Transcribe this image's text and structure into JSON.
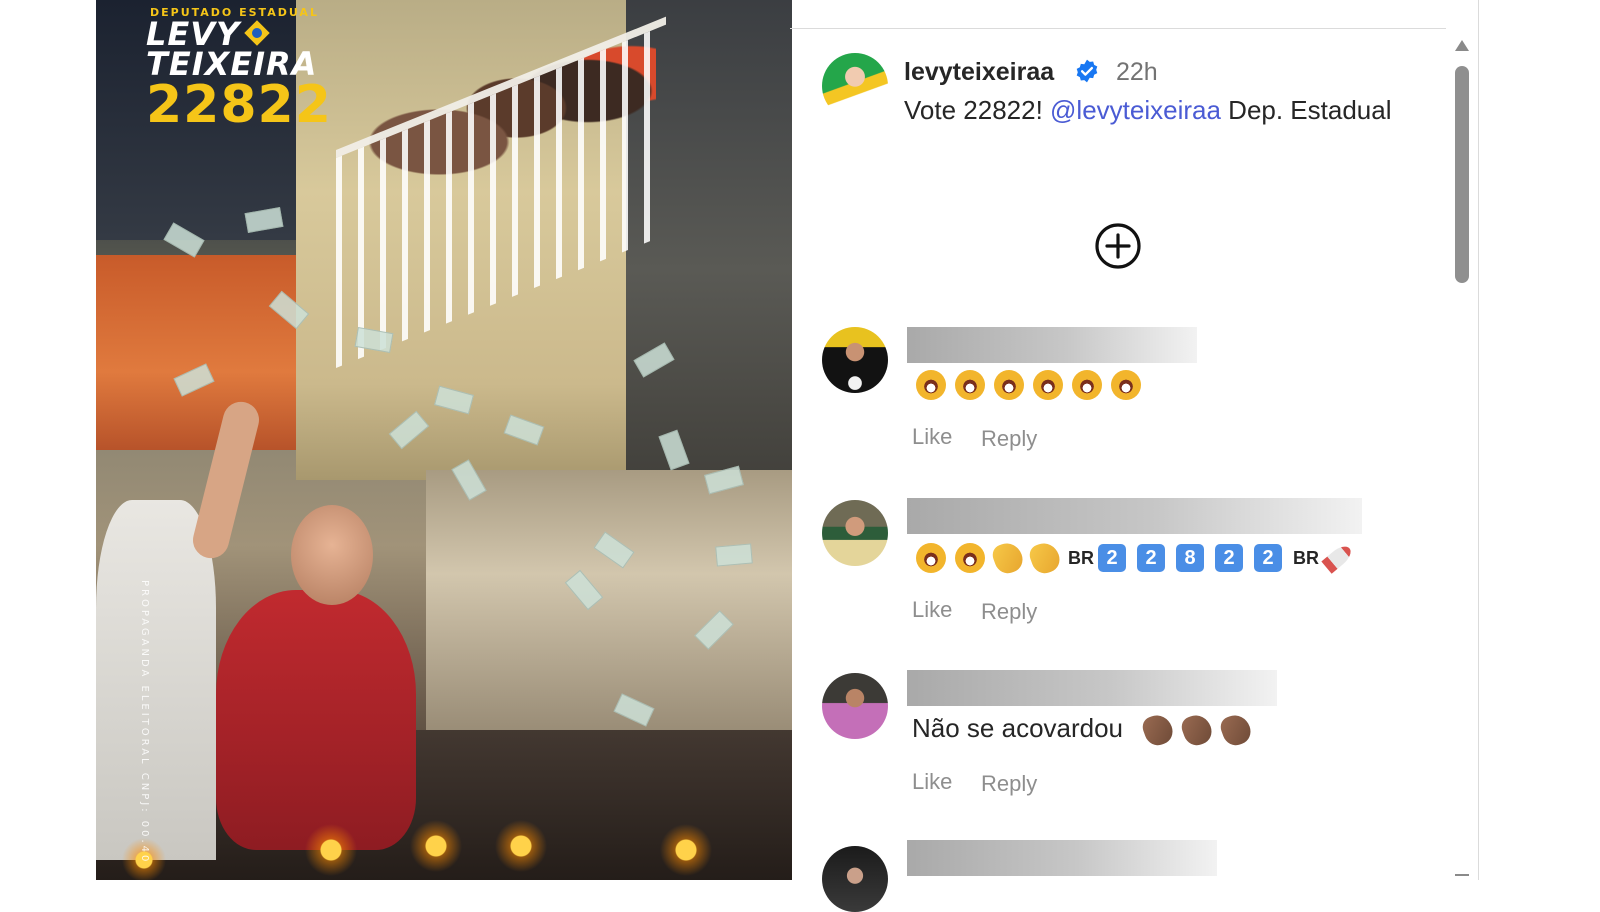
{
  "media": {
    "logo_superscript": "DEPUTADO ESTADUAL",
    "logo_line1": "LEVY",
    "logo_line2": "TEIXEIRA",
    "logo_number": "22822",
    "vertical_text": "PROPAGANDA ELEITORAL CNPJ: 00.40"
  },
  "post": {
    "username": "levyteixeiraa",
    "verified": true,
    "time": "22h",
    "caption_before": "Vote 22822! ",
    "caption_mention": "@levyteixeiraa",
    "caption_after": " Dep. Estadual",
    "add_icon": "plus-circle-icon"
  },
  "comments": [
    {
      "username_redacted": true,
      "emoji_summary": "laughing-crying x6",
      "like_label": "Like",
      "reply_label": "Reply"
    },
    {
      "username_redacted": true,
      "flag_label_1": "BR",
      "digits": [
        "2",
        "2",
        "8",
        "2",
        "2"
      ],
      "flag_label_2": "BR",
      "like_label": "Like",
      "reply_label": "Reply"
    },
    {
      "username_redacted": true,
      "text": "Não se acovardou",
      "like_label": "Like",
      "reply_label": "Reply"
    },
    {
      "username_redacted": true
    }
  ],
  "colors": {
    "mention": "#4a5bd4",
    "verified": "#1877f2",
    "logo_yellow": "#f5c518"
  }
}
